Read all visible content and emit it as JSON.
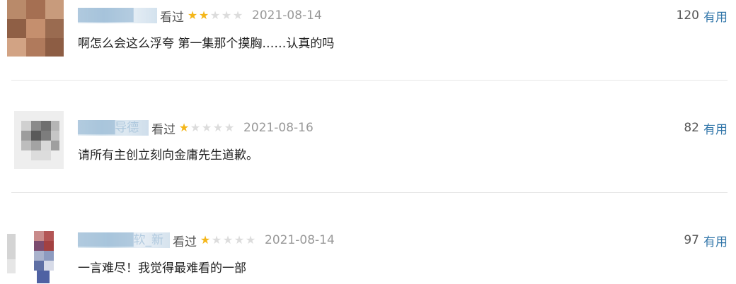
{
  "comments": [
    {
      "username": "██████",
      "status": "看过",
      "rating": 2,
      "date": "2021-08-14",
      "votes": "120",
      "useful_label": "有用",
      "text": "啊怎么会这么浮夸 第一集那个摸胸……认真的吗"
    },
    {
      "username": "████导德",
      "status": "看过",
      "rating": 1,
      "date": "2021-08-16",
      "votes": "82",
      "useful_label": "有用",
      "text": "请所有主创立刻向金庸先生道歉。"
    },
    {
      "username": "██████软_新",
      "status": "看过",
      "rating": 1,
      "date": "2021-08-14",
      "votes": "97",
      "useful_label": "有用",
      "text": "一言难尽！我觉得最难看的一部"
    }
  ],
  "colors": {
    "link": "#3377aa",
    "star_on": "#f4b619",
    "star_off": "#dcdcdc",
    "date": "#999999",
    "divider": "#e8e8e8"
  }
}
